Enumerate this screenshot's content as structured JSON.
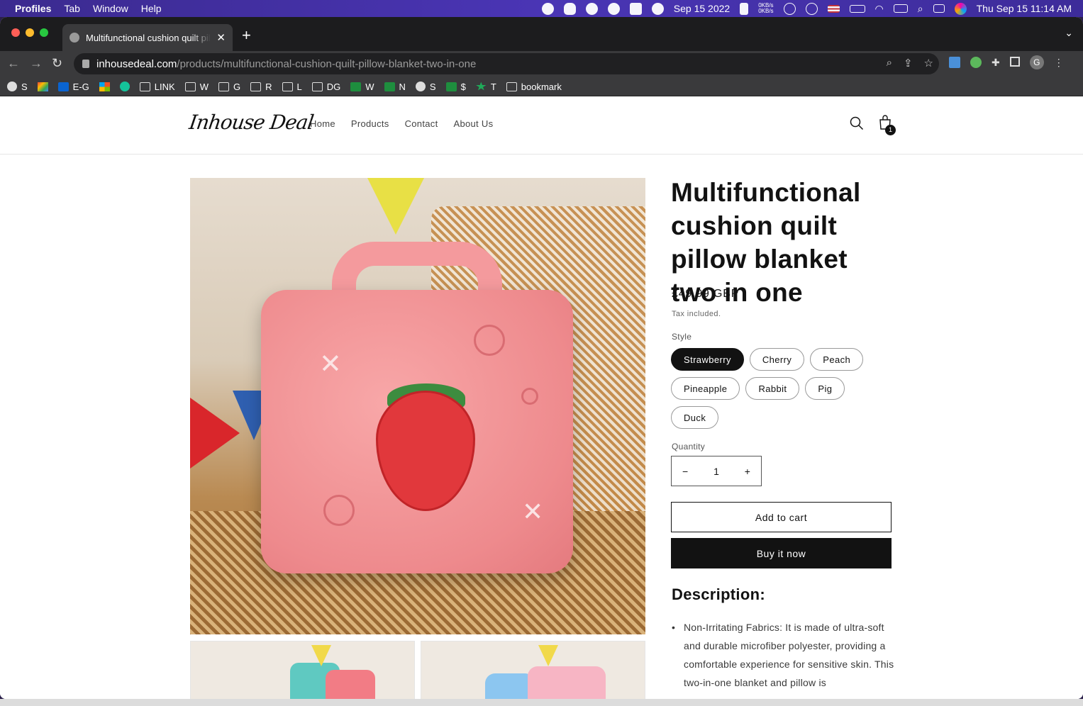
{
  "menubar": {
    "items": [
      "Profiles",
      "Tab",
      "Window",
      "Help"
    ],
    "date_chip": "Sep 15 2022",
    "net_up": "0KB/s",
    "net_down": "0KB/s",
    "clock": "Thu Sep 15  11:14 AM"
  },
  "browser": {
    "tab_title": "Multifunctional cushion quilt pillow blanket two in one",
    "url_host": "inhousedeal.com",
    "url_path": "/products/multifunctional-cushion-quilt-pillow-blanket-two-in-one",
    "profile_initial": "G",
    "bookmarks": [
      {
        "label": "S",
        "icon": "globe-icon"
      },
      {
        "label": "",
        "icon": "gmail-icon"
      },
      {
        "label": "E-G",
        "icon": "outlook-icon"
      },
      {
        "label": "",
        "icon": "microsoft-icon"
      },
      {
        "label": "",
        "icon": "grammarly-icon"
      },
      {
        "label": "LINK",
        "icon": "folder-icon"
      },
      {
        "label": "W",
        "icon": "folder-icon"
      },
      {
        "label": "G",
        "icon": "folder-icon"
      },
      {
        "label": "R",
        "icon": "folder-icon"
      },
      {
        "label": "L",
        "icon": "folder-icon"
      },
      {
        "label": "DG",
        "icon": "folder-icon"
      },
      {
        "label": "W",
        "icon": "green-plus-icon"
      },
      {
        "label": "N",
        "icon": "green-plus-icon"
      },
      {
        "label": "S",
        "icon": "globe-icon"
      },
      {
        "label": "$",
        "icon": "green-plus-icon"
      },
      {
        "label": "T",
        "icon": "star-icon"
      },
      {
        "label": "bookmark",
        "icon": "folder-icon"
      }
    ]
  },
  "site": {
    "logo": "Inhouse Deal",
    "nav": [
      "Home",
      "Products",
      "Contact",
      "About Us"
    ],
    "cart_count": "1"
  },
  "product": {
    "title": "Multifunctional cushion quilt pillow blanket two in one",
    "price": "£49.99 GBP",
    "tax_note": "Tax included.",
    "style_label": "Style",
    "styles": [
      "Strawberry",
      "Cherry",
      "Peach",
      "Pineapple",
      "Rabbit",
      "Pig",
      "Duck"
    ],
    "selected_style": "Strawberry",
    "quantity_label": "Quantity",
    "quantity": "1",
    "minus": "−",
    "plus": "+",
    "add_to_cart": "Add to cart",
    "buy_now": "Buy it now",
    "description_heading": "Description:",
    "description_bullet": "Non-Irritating Fabrics: It is made of ultra-soft and durable microfiber polyester, providing a comfortable experience for sensitive skin. This two-in-one blanket and pillow is"
  },
  "colors": {
    "accent": "#121212",
    "menubar": "#4a35b5"
  }
}
